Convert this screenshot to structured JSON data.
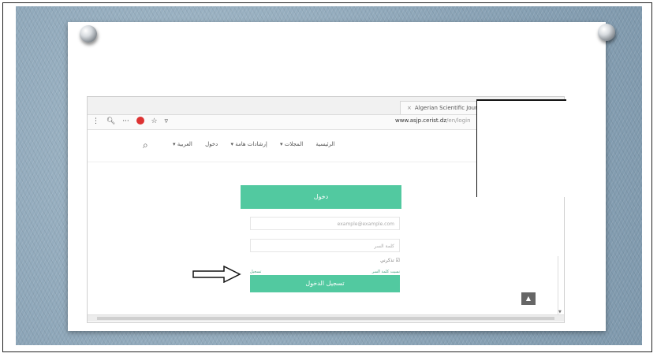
{
  "browser": {
    "tab_title": "Algerian Scientific Journ",
    "tab_close": "×",
    "url_main": "www.asjp.cerist.dz",
    "url_rest": "/en/login",
    "toolbar_icons": [
      "menu-icon",
      "search-icon",
      "more-icon",
      "adblock-icon",
      "star-icon",
      "filter-icon"
    ]
  },
  "site_nav": {
    "items": [
      "الرئيسية",
      "المجلات ▾",
      "إرشادات هامة ▾",
      "دخول",
      "العربية ▾"
    ]
  },
  "login": {
    "header": "دخول",
    "email_placeholder": "example@example.com",
    "password_placeholder": "كلمة السر",
    "remember_label": "تذكرني ☑",
    "register_link": "تسجيل",
    "forgot_link": "نسيت كلمة السر",
    "submit_label": "تسجيل الدخول",
    "back_to_top": "▲"
  },
  "colors": {
    "accent": "#52c9a0",
    "board": "#8ea9bd"
  }
}
